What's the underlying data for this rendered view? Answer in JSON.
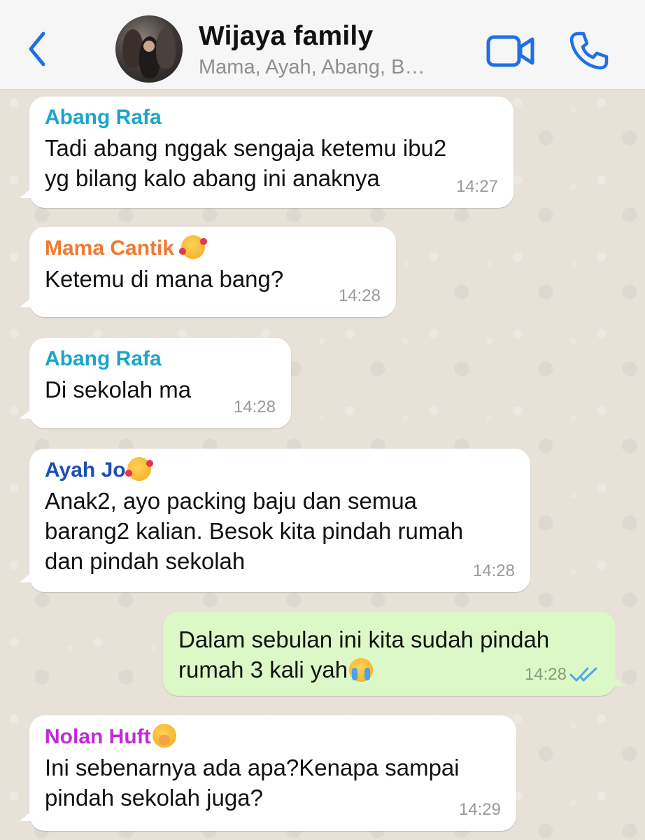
{
  "header": {
    "back_icon": "chevron-left-icon",
    "title": "Wijaya family",
    "subtitle": "Mama, Ayah, Abang, B…",
    "video_icon": "video-camera-icon",
    "phone_icon": "phone-icon",
    "accent_color": "#1f6fe5"
  },
  "messages": [
    {
      "sender": "Abang Rafa",
      "sender_color": "#1aa6c9",
      "lines": [
        "Tadi abang nggak sengaja ketemu ibu2",
        "yg bilang kalo abang ini anaknya"
      ],
      "time": "14:27"
    },
    {
      "sender": "Mama Cantik",
      "sender_color": "#f07a2e",
      "sender_emoji": "smiling-face-with-hearts",
      "lines": [
        "Ketemu di mana bang?"
      ],
      "time": "14:28"
    },
    {
      "sender": "Abang Rafa",
      "sender_color": "#1aa6c9",
      "lines": [
        "Di sekolah ma"
      ],
      "time": "14:28"
    },
    {
      "sender": "Ayah Jo",
      "sender_color": "#1d4fb3",
      "sender_emoji": "smiling-face-with-hearts",
      "lines": [
        "Anak2, ayo packing baju dan semua",
        "barang2 kalian. Besok kita pindah rumah",
        "dan pindah sekolah"
      ],
      "time": "14:28"
    },
    {
      "outgoing": true,
      "lines": [
        "Dalam sebulan ini kita sudah pindah",
        "rumah 3 kali yah"
      ],
      "line_emoji": "loudly-crying-face",
      "time": "14:28",
      "status_icon": "double-check-read-icon"
    },
    {
      "sender": "Nolan Huft",
      "sender_color": "#c02cd6",
      "sender_emoji": "yawning-face",
      "lines": [
        "Ini sebenarnya ada apa?Kenapa sampai",
        "pindah sekolah juga?"
      ],
      "time": "14:29"
    }
  ]
}
